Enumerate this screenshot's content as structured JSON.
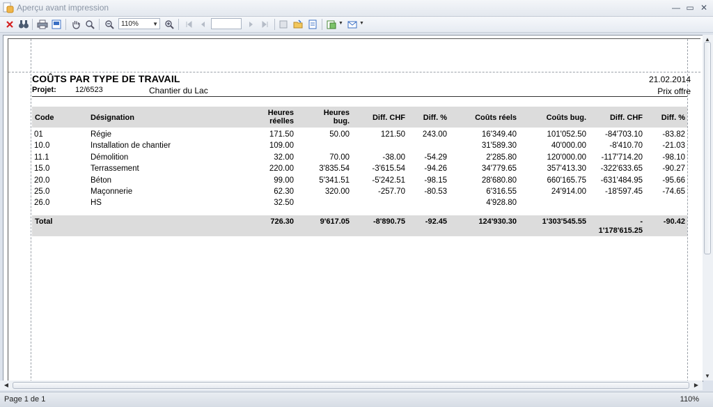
{
  "window": {
    "title": "Aperçu avant impression"
  },
  "toolbar": {
    "zoom_value": "110%"
  },
  "report": {
    "title": "COÛTS PAR TYPE DE TRAVAIL",
    "date": "21.02.2014",
    "project_label": "Projet:",
    "project_number": "12/6523",
    "project_name": "Chantier du Lac",
    "offer_label": "Prix offre",
    "headers": {
      "code": "Code",
      "designation": "Désignation",
      "heures_reelles_1": "Heures",
      "heures_reelles_2": "réelles",
      "heures_bug_1": "Heures",
      "heures_bug_2": "bug.",
      "diff_chf_1": "Diff. CHF",
      "diff_pct_1": "Diff. %",
      "couts_reels": "Coûts réels",
      "couts_bug": "Coûts bug.",
      "diff_chf_2": "Diff. CHF",
      "diff_pct_2": "Diff. %"
    },
    "rows": [
      {
        "code": "01",
        "designation": "Régie",
        "h_reel": "171.50",
        "h_bug": "50.00",
        "diff_chf": "121.50",
        "diff_pct": "243.00",
        "c_reel": "16'349.40",
        "c_bug": "101'052.50",
        "diff_chf2": "-84'703.10",
        "diff_pct2": "-83.82"
      },
      {
        "code": "10.0",
        "designation": "Installation de chantier",
        "h_reel": "109.00",
        "h_bug": "",
        "diff_chf": "",
        "diff_pct": "",
        "c_reel": "31'589.30",
        "c_bug": "40'000.00",
        "diff_chf2": "-8'410.70",
        "diff_pct2": "-21.03"
      },
      {
        "code": "11.1",
        "designation": "Démolition",
        "h_reel": "32.00",
        "h_bug": "70.00",
        "diff_chf": "-38.00",
        "diff_pct": "-54.29",
        "c_reel": "2'285.80",
        "c_bug": "120'000.00",
        "diff_chf2": "-117'714.20",
        "diff_pct2": "-98.10"
      },
      {
        "code": "15.0",
        "designation": "Terrassement",
        "h_reel": "220.00",
        "h_bug": "3'835.54",
        "diff_chf": "-3'615.54",
        "diff_pct": "-94.26",
        "c_reel": "34'779.65",
        "c_bug": "357'413.30",
        "diff_chf2": "-322'633.65",
        "diff_pct2": "-90.27"
      },
      {
        "code": "20.0",
        "designation": "Béton",
        "h_reel": "99.00",
        "h_bug": "5'341.51",
        "diff_chf": "-5'242.51",
        "diff_pct": "-98.15",
        "c_reel": "28'680.80",
        "c_bug": "660'165.75",
        "diff_chf2": "-631'484.95",
        "diff_pct2": "-95.66"
      },
      {
        "code": "25.0",
        "designation": "Maçonnerie",
        "h_reel": "62.30",
        "h_bug": "320.00",
        "diff_chf": "-257.70",
        "diff_pct": "-80.53",
        "c_reel": "6'316.55",
        "c_bug": "24'914.00",
        "diff_chf2": "-18'597.45",
        "diff_pct2": "-74.65"
      },
      {
        "code": "26.0",
        "designation": "HS",
        "h_reel": "32.50",
        "h_bug": "",
        "diff_chf": "",
        "diff_pct": "",
        "c_reel": "4'928.80",
        "c_bug": "",
        "diff_chf2": "",
        "diff_pct2": ""
      }
    ],
    "total": {
      "label": "Total",
      "h_reel": "726.30",
      "h_bug": "9'617.05",
      "diff_chf": "-8'890.75",
      "diff_pct": "-92.45",
      "c_reel": "124'930.30",
      "c_bug": "1'303'545.55",
      "diff_chf2_line1": "-",
      "diff_chf2_line2": "1'178'615.25",
      "diff_pct2": "-90.42"
    }
  },
  "status": {
    "page": "Page 1 de 1",
    "zoom": "110%"
  }
}
